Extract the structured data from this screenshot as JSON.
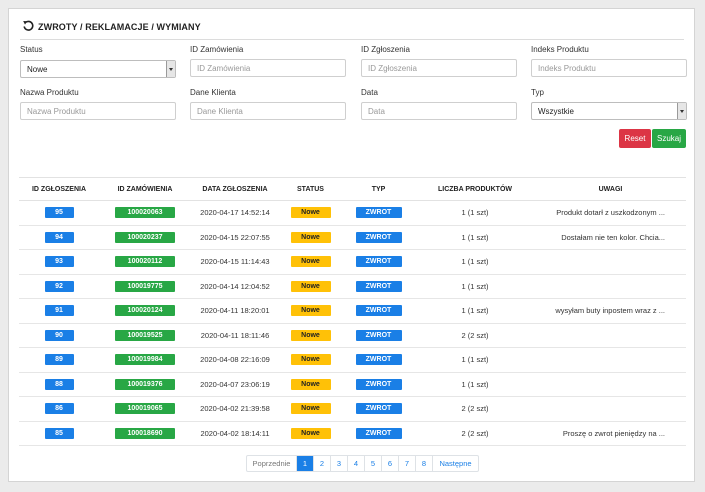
{
  "header": {
    "title": "ZWROTY / REKLAMACJE / WYMIANY",
    "icon": "refresh-icon"
  },
  "filters": {
    "status": {
      "label": "Status",
      "value": "Nowe"
    },
    "order_id": {
      "label": "ID Zamówienia",
      "placeholder": "ID Zamówienia"
    },
    "request_id": {
      "label": "ID Zgłoszenia",
      "placeholder": "ID Zgłoszenia"
    },
    "product_index": {
      "label": "Indeks Produktu",
      "placeholder": "Indeks Produktu"
    },
    "product_name": {
      "label": "Nazwa Produktu",
      "placeholder": "Nazwa Produktu"
    },
    "customer": {
      "label": "Dane Klienta",
      "placeholder": "Dane Klienta"
    },
    "date": {
      "label": "Data",
      "placeholder": "Data"
    },
    "type": {
      "label": "Typ",
      "value": "Wszystkie"
    },
    "reset_label": "Reset",
    "search_label": "Szukaj"
  },
  "table": {
    "columns": [
      "ID ZGŁOSZENIA",
      "ID ZAMÓWIENIA",
      "DATA ZGŁOSZENIA",
      "STATUS",
      "TYP",
      "LICZBA PRODUKTÓW",
      "UWAGI"
    ],
    "rows": [
      {
        "id": "95",
        "order": "100020063",
        "date": "2020-04-17 14:52:14",
        "status": "Nowe",
        "type": "ZWROT",
        "count": "1 (1 szt)",
        "notes": "Produkt dotarł z uszkodzonym ..."
      },
      {
        "id": "94",
        "order": "100020237",
        "date": "2020-04-15 22:07:55",
        "status": "Nowe",
        "type": "ZWROT",
        "count": "1 (1 szt)",
        "notes": "Dostałam nie ten kolor. Chcia..."
      },
      {
        "id": "93",
        "order": "100020112",
        "date": "2020-04-15 11:14:43",
        "status": "Nowe",
        "type": "ZWROT",
        "count": "1 (1 szt)",
        "notes": ""
      },
      {
        "id": "92",
        "order": "100019775",
        "date": "2020-04-14 12:04:52",
        "status": "Nowe",
        "type": "ZWROT",
        "count": "1 (1 szt)",
        "notes": ""
      },
      {
        "id": "91",
        "order": "100020124",
        "date": "2020-04-11 18:20:01",
        "status": "Nowe",
        "type": "ZWROT",
        "count": "1 (1 szt)",
        "notes": "wysyłam buty inpostem wraz z ..."
      },
      {
        "id": "90",
        "order": "100019525",
        "date": "2020-04-11 18:11:46",
        "status": "Nowe",
        "type": "ZWROT",
        "count": "2 (2 szt)",
        "notes": ""
      },
      {
        "id": "89",
        "order": "100019984",
        "date": "2020-04-08 22:16:09",
        "status": "Nowe",
        "type": "ZWROT",
        "count": "1 (1 szt)",
        "notes": ""
      },
      {
        "id": "88",
        "order": "100019376",
        "date": "2020-04-07 23:06:19",
        "status": "Nowe",
        "type": "ZWROT",
        "count": "1 (1 szt)",
        "notes": ""
      },
      {
        "id": "86",
        "order": "100019065",
        "date": "2020-04-02 21:39:58",
        "status": "Nowe",
        "type": "ZWROT",
        "count": "2 (2 szt)",
        "notes": ""
      },
      {
        "id": "85",
        "order": "100018690",
        "date": "2020-04-02 18:14:11",
        "status": "Nowe",
        "type": "ZWROT",
        "count": "2 (2 szt)",
        "notes": "Proszę o zwrot pieniędzy na ..."
      }
    ]
  },
  "pagination": {
    "prev": "Poprzednie",
    "pages": [
      "1",
      "2",
      "3",
      "4",
      "5",
      "6",
      "7",
      "8"
    ],
    "current": "1",
    "next": "Następne"
  },
  "colors": {
    "blue": "#1a7fe6",
    "green": "#28a745",
    "yellow": "#ffc107",
    "red": "#dc3545"
  }
}
